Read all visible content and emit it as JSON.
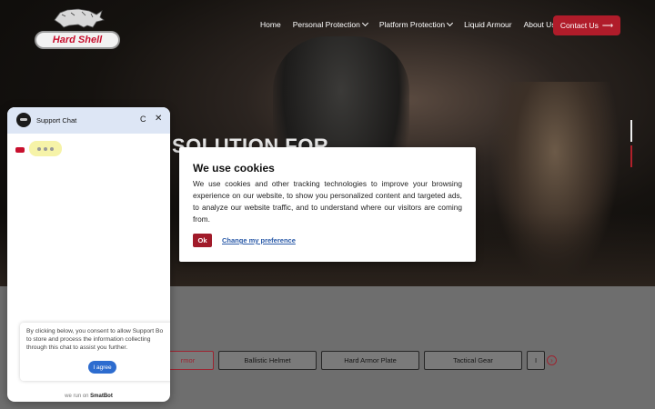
{
  "header": {
    "logo_text": "Hard Shell",
    "nav": [
      {
        "label": "Home",
        "dropdown": false
      },
      {
        "label": "Personal Protection",
        "dropdown": true
      },
      {
        "label": "Platform Protection",
        "dropdown": true
      },
      {
        "label": "Liquid Armour",
        "dropdown": false
      },
      {
        "label": "About Us",
        "dropdown": true
      }
    ],
    "contact_label": "Contact Us",
    "contact_arrow": "⟶"
  },
  "hero": {
    "headline": "OP SOLUTION FOR"
  },
  "cookie": {
    "title": "We use cookies",
    "body": "We use cookies and other tracking technologies to improve your browsing experience on our website, to show you personalized content and targeted ads, to analyze our website traffic, and to understand where our visitors are coming from.",
    "ok_label": "Ok",
    "pref_label": "Change my preference"
  },
  "chat": {
    "title": "Support Chat",
    "refresh_glyph": "C",
    "close_glyph": "✕",
    "consent_lines": [
      "By clicking below, you consent to allow Support Bo",
      "to store and process the information collecting",
      "through this chat to assist you further."
    ],
    "agree_label": "I agree",
    "powered_prefix": "we run on",
    "powered_brand": "SmatBot"
  },
  "tabs": [
    {
      "label": "rmor",
      "active": true
    },
    {
      "label": "Ballistic Helmet",
      "active": false
    },
    {
      "label": "Hard Armor Plate",
      "active": false
    },
    {
      "label": "Tactical Gear",
      "active": false
    },
    {
      "label": "I",
      "active": false
    }
  ],
  "tab_next_glyph": "›",
  "colors": {
    "accent": "#b01c2a",
    "link": "#2a5aa8",
    "chat_header": "#dde6f5",
    "agree": "#2d6ccf"
  }
}
